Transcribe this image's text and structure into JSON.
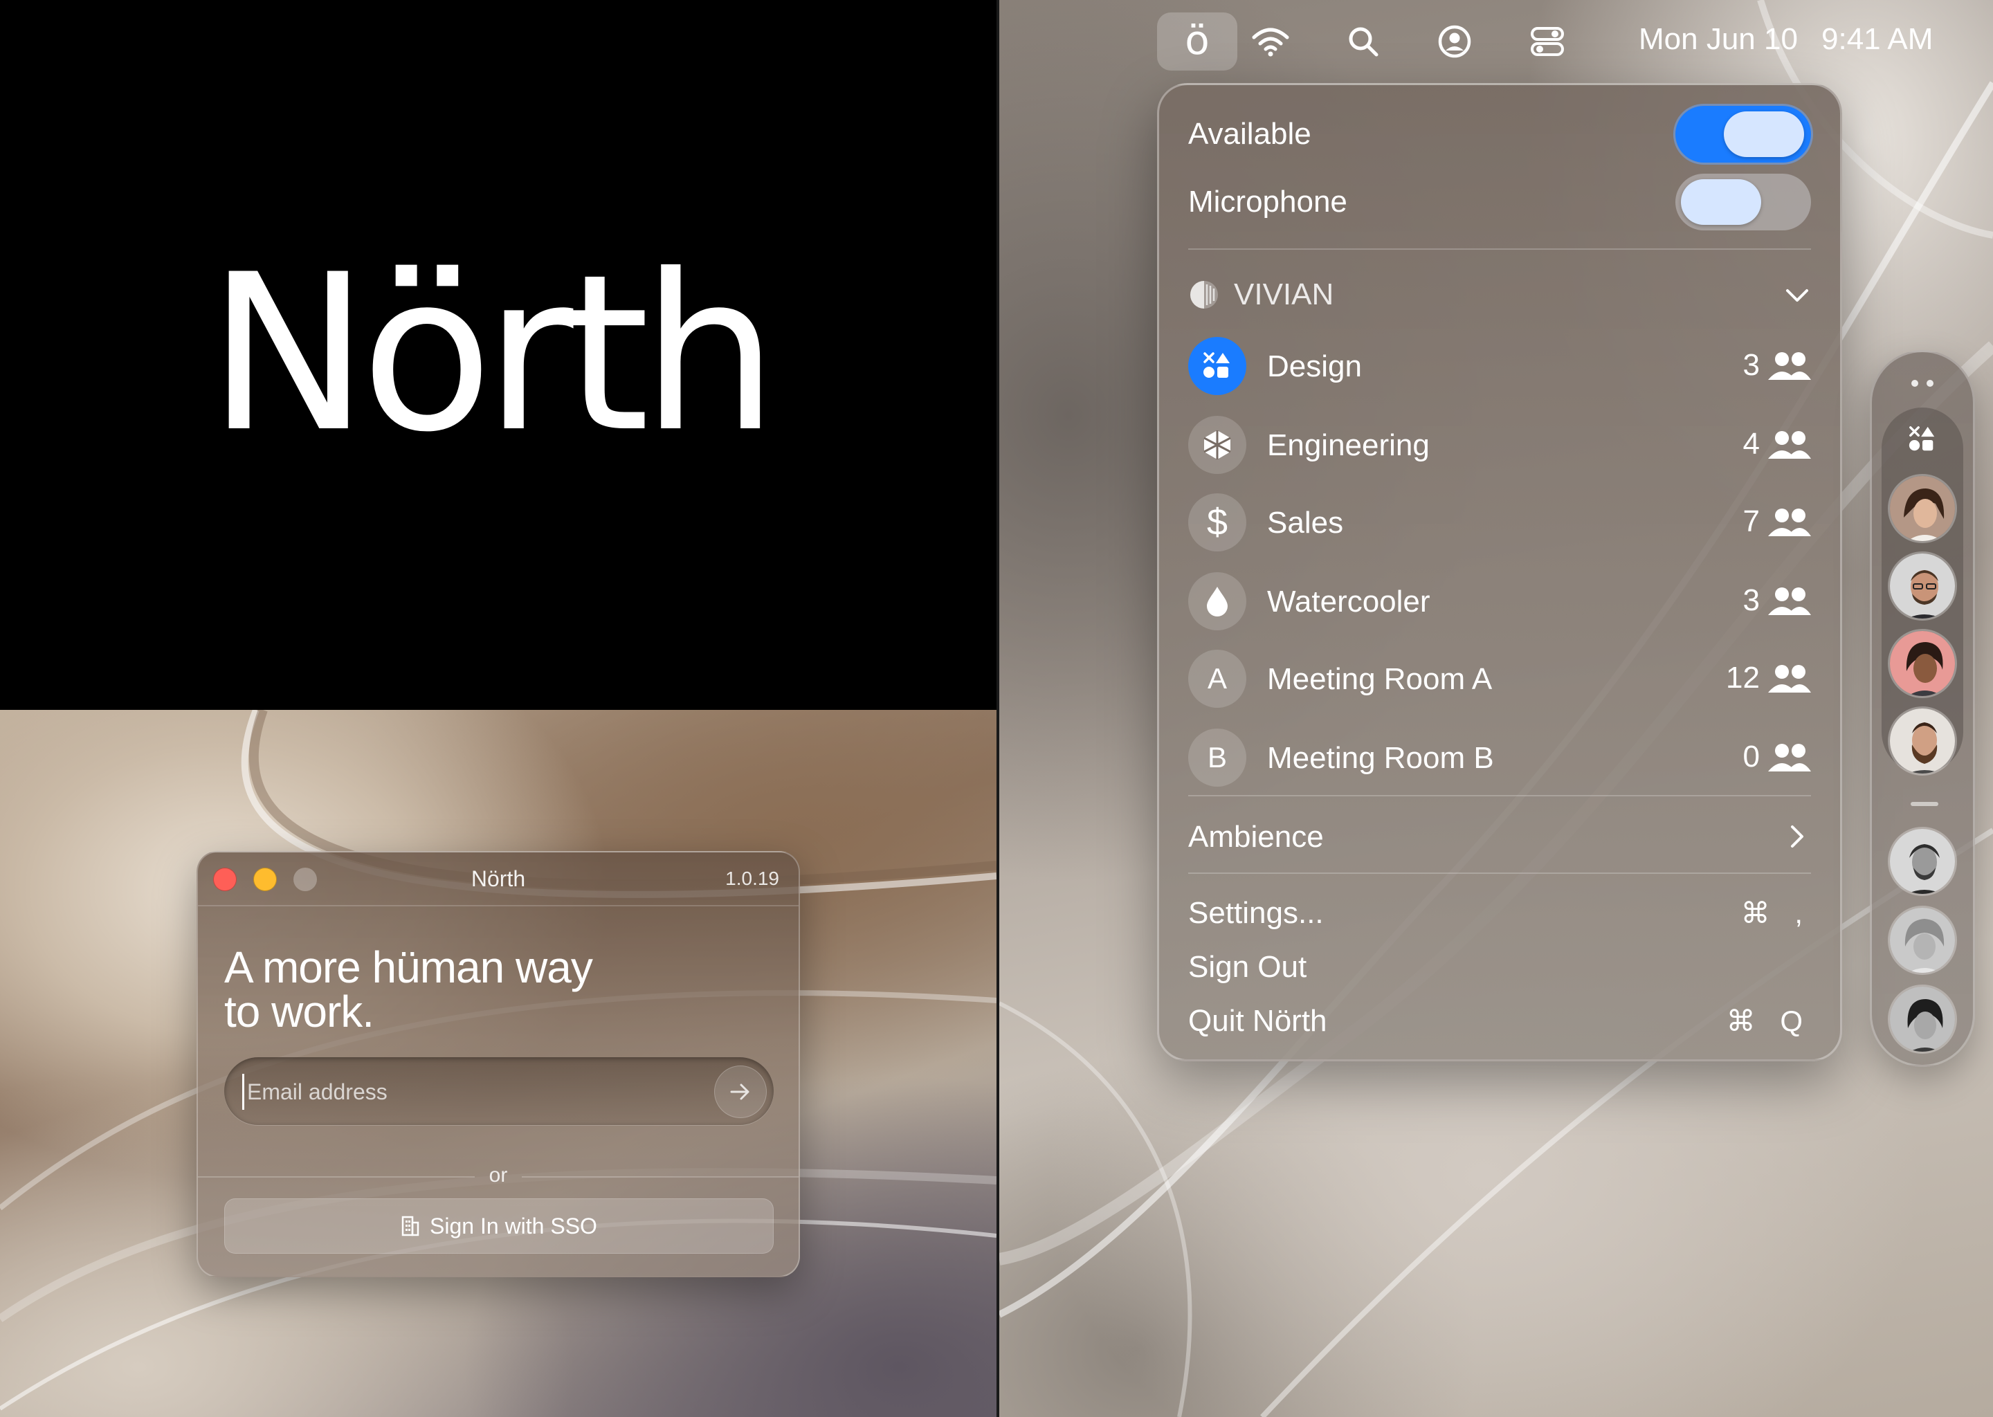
{
  "brand": {
    "logo_text": "Nörth"
  },
  "login": {
    "window_title": "Nörth",
    "version": "1.0.19",
    "headline_line1": "A more hüman way",
    "headline_line2": "to work.",
    "email_placeholder": "Email address",
    "or_label": "or",
    "sso_label": "Sign In with SSO"
  },
  "menubar": {
    "app_glyph": "ö",
    "date": "Mon Jun 10",
    "time": "9:41 AM"
  },
  "panel": {
    "available_label": "Available",
    "available_on": true,
    "microphone_label": "Microphone",
    "microphone_on": false,
    "org_name": "VIVIAN",
    "rooms": [
      {
        "name": "Design",
        "count": "3",
        "badge": "",
        "icon": "design-shapes-icon",
        "active": true
      },
      {
        "name": "Engineering",
        "count": "4",
        "badge": "",
        "icon": "cube-icon",
        "active": false
      },
      {
        "name": "Sales",
        "count": "7",
        "badge": "$",
        "icon": "dollar-icon",
        "active": false
      },
      {
        "name": "Watercooler",
        "count": "3",
        "badge": "",
        "icon": "droplet-icon",
        "active": false
      },
      {
        "name": "Meeting Room A",
        "count": "12",
        "badge": "A",
        "icon": "letter-a-icon",
        "active": false
      },
      {
        "name": "Meeting Room B",
        "count": "0",
        "badge": "B",
        "icon": "letter-b-icon",
        "active": false
      }
    ],
    "ambience_label": "Ambience",
    "menu": [
      {
        "label": "Settings...",
        "shortcut": "⌘ ,"
      },
      {
        "label": "Sign Out",
        "shortcut": ""
      },
      {
        "label": "Quit Nörth",
        "shortcut": "⌘ Q"
      }
    ]
  },
  "colors": {
    "accent_blue": "#1a7cff",
    "traffic_close": "#fe5f57",
    "traffic_min": "#febc2e",
    "toggle_knob": "#d6e6ff"
  }
}
